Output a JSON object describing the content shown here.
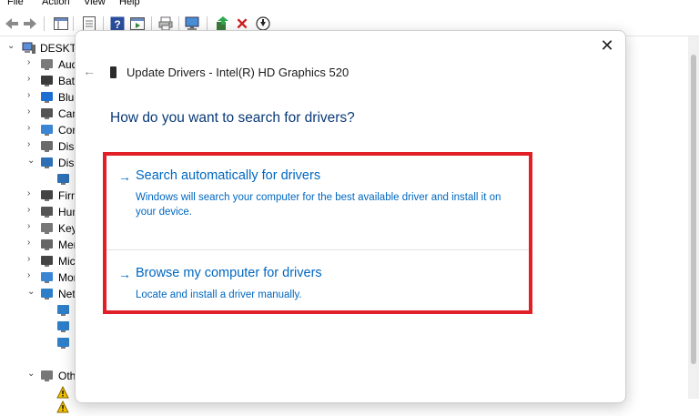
{
  "menu": {
    "file": "File",
    "action": "Action",
    "view": "View",
    "help": "Help"
  },
  "tree": {
    "root_label": "DESKTO",
    "items": [
      {
        "label": "Aud",
        "icon": "speaker-icon",
        "chev": "›"
      },
      {
        "label": "Bat",
        "icon": "battery-icon",
        "chev": "›"
      },
      {
        "label": "Blu",
        "icon": "bluetooth-icon",
        "chev": "›"
      },
      {
        "label": "Can",
        "icon": "camera-icon",
        "chev": "›"
      },
      {
        "label": "Con",
        "icon": "monitor-icon",
        "chev": "›"
      },
      {
        "label": "Disl",
        "icon": "disk-icon",
        "chev": "›"
      },
      {
        "label": "Disp",
        "icon": "display-adapter-icon",
        "chev": "⌄"
      },
      {
        "label": "",
        "icon": "display-adapter-child-icon",
        "chev": ""
      },
      {
        "label": "Firm",
        "icon": "firmware-icon",
        "chev": "›"
      },
      {
        "label": "Hun",
        "icon": "hid-icon",
        "chev": "›"
      },
      {
        "label": "Key",
        "icon": "keyboard-icon",
        "chev": "›"
      },
      {
        "label": "Mer",
        "icon": "memory-icon",
        "chev": "›"
      },
      {
        "label": "Mic",
        "icon": "mouse-icon",
        "chev": "›"
      },
      {
        "label": "Mor",
        "icon": "monitor-icon",
        "chev": "›"
      },
      {
        "label": "Net",
        "icon": "network-icon",
        "chev": "⌄"
      },
      {
        "label": "",
        "icon": "network-adapter-icon",
        "chev": ""
      },
      {
        "label": "",
        "icon": "network-adapter-icon",
        "chev": ""
      },
      {
        "label": "",
        "icon": "network-adapter-icon",
        "chev": ""
      },
      {
        "label": "",
        "icon": "",
        "chev": ""
      },
      {
        "label": "Oth",
        "icon": "other-devices-icon",
        "chev": "⌄"
      },
      {
        "label": "",
        "icon": "warning-device-icon",
        "chev": ""
      },
      {
        "label": "",
        "icon": "warning-device-icon",
        "chev": ""
      }
    ]
  },
  "dialog": {
    "title": "Update Drivers - Intel(R) HD Graphics 520",
    "question": "How do you want to search for drivers?",
    "close_glyph": "✕",
    "back_glyph": "←",
    "option1": {
      "arrow": "→",
      "title": "Search automatically for drivers",
      "desc": "Windows will search your computer for the best available driver and install it on your device."
    },
    "option2": {
      "arrow": "→",
      "title": "Browse my computer for drivers",
      "desc": "Locate and install a driver manually."
    }
  },
  "colors": {
    "link": "#0067c0",
    "heading": "#0a3a78",
    "highlight": "#e01f26"
  }
}
